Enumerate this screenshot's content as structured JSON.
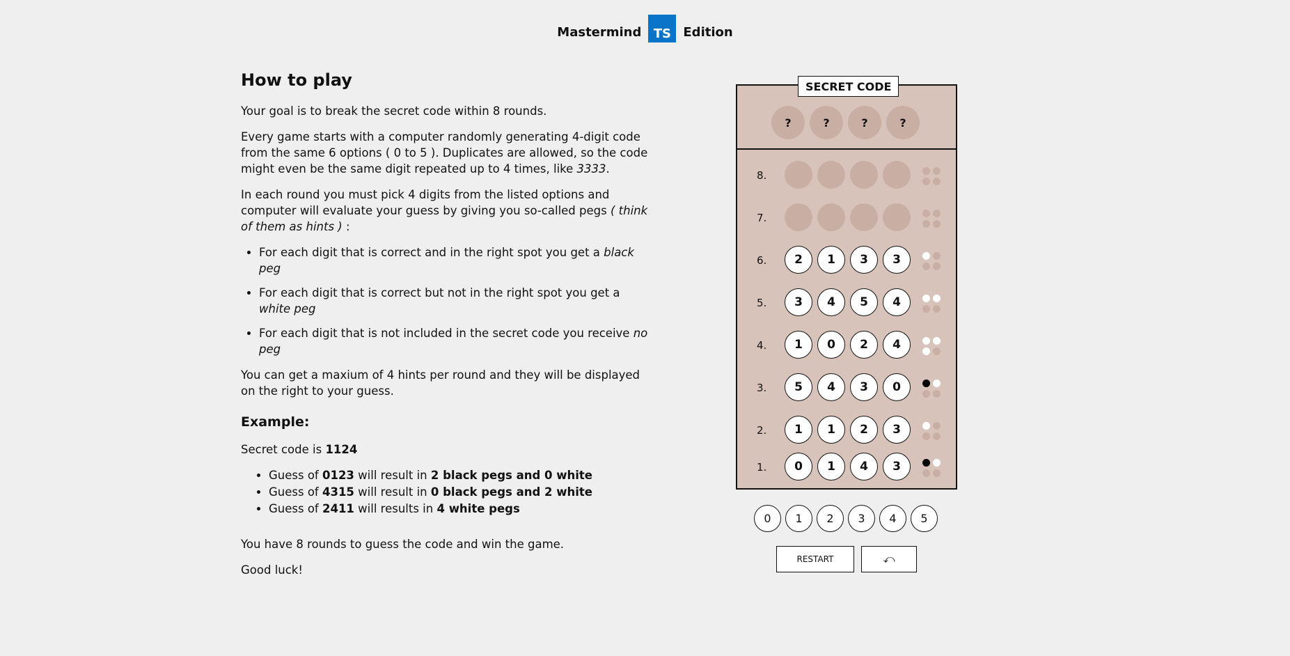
{
  "header": {
    "title_left": "Mastermind",
    "logo": "TS",
    "title_right": "Edition",
    "logo_color": "#0a74c9"
  },
  "howto": {
    "heading": "How to play",
    "p1": "Your goal is to break the secret code within 8 rounds.",
    "p2a": "Every game starts with a computer randomly generating 4-digit code from the same 6 options ( 0 to 5 ). Duplicates are allowed, so the code might even be the same digit repeated up to 4 times, like ",
    "p2b": "3333",
    "p2c": ".",
    "p3a": "In each round you must pick 4 digits from the listed options and computer will evaluate your guess by giving you so-called pegs ",
    "p3b": "( think of them as hints )",
    "p3c": " :",
    "rules": [
      {
        "text": "For each digit that is correct and in the right spot you get a ",
        "em": "black peg"
      },
      {
        "text": "For each digit that is correct but not in the right spot you get a ",
        "em": "white peg"
      },
      {
        "text": "For each digit that is not included in the secret code you receive ",
        "em": "no peg"
      }
    ],
    "p4": "You can get a maxium of 4 hints per round and they will be displayed on the right to your guess.",
    "example_heading": "Example:",
    "secret_prefix": "Secret code is ",
    "secret_value": "1124",
    "examples": [
      {
        "a": "Guess of ",
        "code": "0123",
        "b": " will result in ",
        "result": "2 black pegs and 0 white"
      },
      {
        "a": "Guess of ",
        "code": "4315",
        "b": " will result in ",
        "result": "0 black pegs and 2 white"
      },
      {
        "a": "Guess of ",
        "code": "2411",
        "b": " will results in ",
        "result": "4 white pegs"
      }
    ],
    "p5": "You have 8 rounds to guess the code and win the game.",
    "p6": "Good luck!"
  },
  "board": {
    "secret_label": "SECRET CODE",
    "secret": [
      "?",
      "?",
      "?",
      "?"
    ],
    "rows": [
      {
        "label": "8.",
        "guess": [],
        "hints": []
      },
      {
        "label": "7.",
        "guess": [],
        "hints": []
      },
      {
        "label": "6.",
        "guess": [
          "2",
          "1",
          "3",
          "3"
        ],
        "hints": [
          "white"
        ]
      },
      {
        "label": "5.",
        "guess": [
          "3",
          "4",
          "5",
          "4"
        ],
        "hints": [
          "white",
          "white"
        ]
      },
      {
        "label": "4.",
        "guess": [
          "1",
          "0",
          "2",
          "4"
        ],
        "hints": [
          "white",
          "white",
          "white"
        ]
      },
      {
        "label": "3.",
        "guess": [
          "5",
          "4",
          "3",
          "0"
        ],
        "hints": [
          "black",
          "white"
        ]
      },
      {
        "label": "2.",
        "guess": [
          "1",
          "1",
          "2",
          "3"
        ],
        "hints": [
          "white"
        ]
      },
      {
        "label": "1.",
        "guess": [
          "0",
          "1",
          "4",
          "3"
        ],
        "hints": [
          "black",
          "white"
        ]
      }
    ]
  },
  "options": [
    "0",
    "1",
    "2",
    "3",
    "4",
    "5"
  ],
  "controls": {
    "restart": "RESTART",
    "undo": "⤺"
  }
}
